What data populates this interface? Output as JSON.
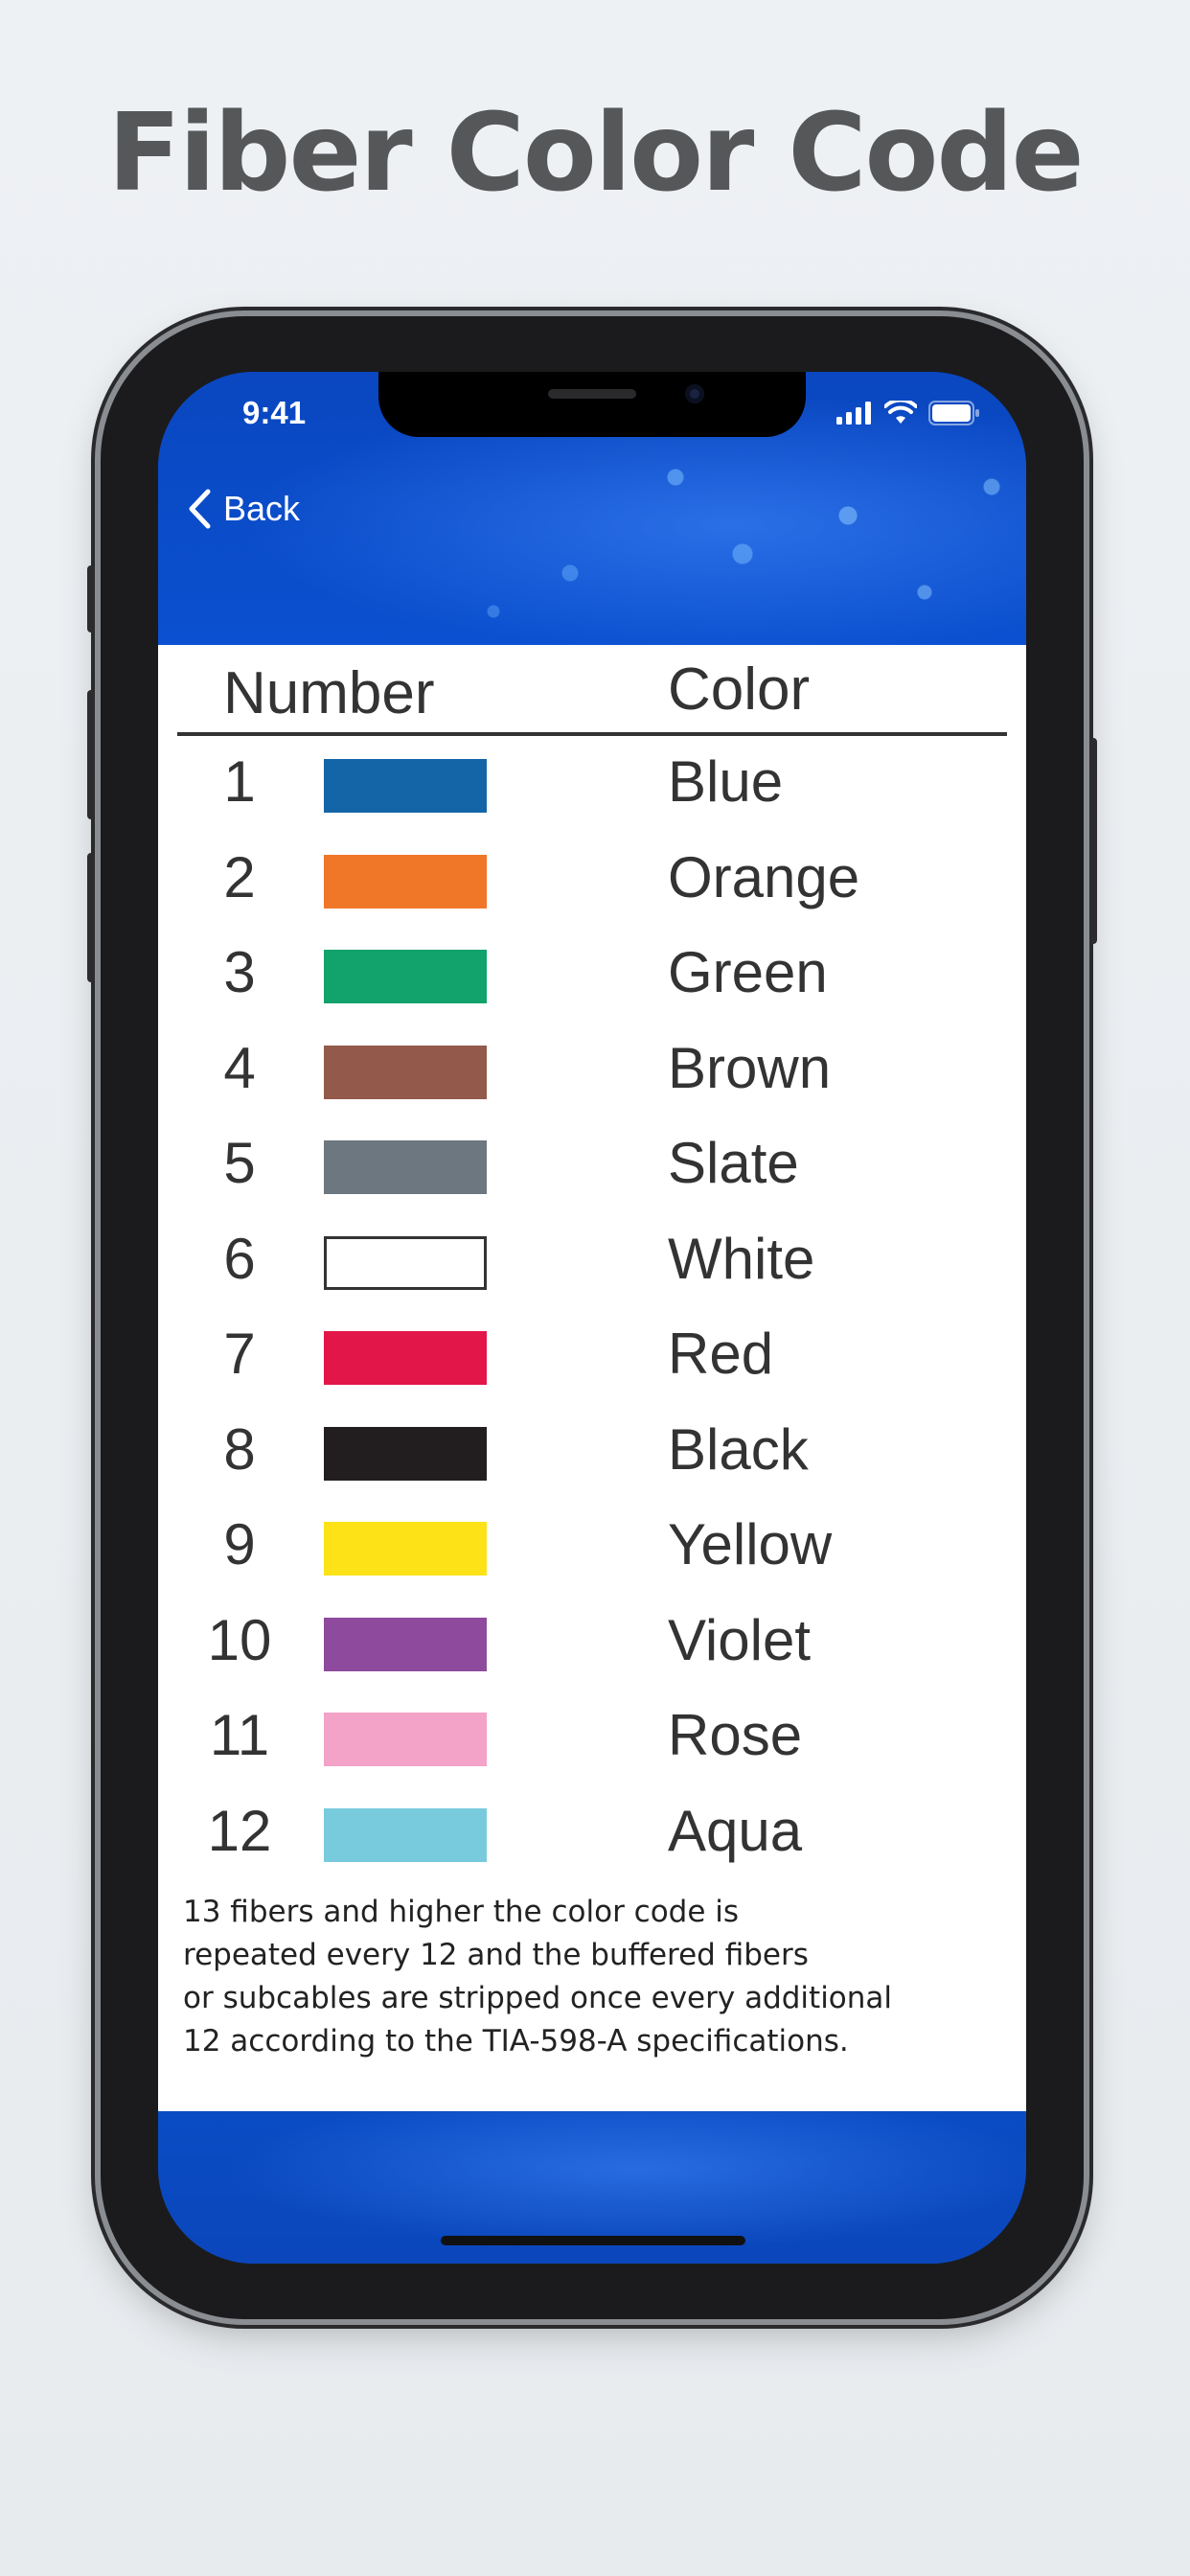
{
  "headline": "Fiber Color Code",
  "status_bar": {
    "time": "9:41",
    "icons": [
      "signal-icon",
      "wifi-icon",
      "battery-icon"
    ]
  },
  "nav": {
    "back_label": "Back"
  },
  "table": {
    "header_number": "Number",
    "header_color": "Color",
    "rows": [
      {
        "number": "1",
        "color": "Blue",
        "swatch": "#1464a8"
      },
      {
        "number": "2",
        "color": "Orange",
        "swatch": "#f07628"
      },
      {
        "number": "3",
        "color": "Green",
        "swatch": "#12a26c"
      },
      {
        "number": "4",
        "color": "Brown",
        "swatch": "#93594b"
      },
      {
        "number": "5",
        "color": "Slate",
        "swatch": "#6d7780"
      },
      {
        "number": "6",
        "color": "White",
        "swatch": "#ffffff"
      },
      {
        "number": "7",
        "color": "Red",
        "swatch": "#e3164a"
      },
      {
        "number": "8",
        "color": "Black",
        "swatch": "#221e20"
      },
      {
        "number": "9",
        "color": "Yellow",
        "swatch": "#fde218"
      },
      {
        "number": "10",
        "color": "Violet",
        "swatch": "#8e4a9c"
      },
      {
        "number": "11",
        "color": "Rose",
        "swatch": "#f3a2c8"
      },
      {
        "number": "12",
        "color": "Aqua",
        "swatch": "#78cbdc"
      }
    ]
  },
  "note_lines": [
    "13 fibers and higher the color code is",
    "repeated every 12 and the buffered fibers",
    "or subcables are stripped once every additional",
    "12 according to the TIA-598-A specifications."
  ]
}
